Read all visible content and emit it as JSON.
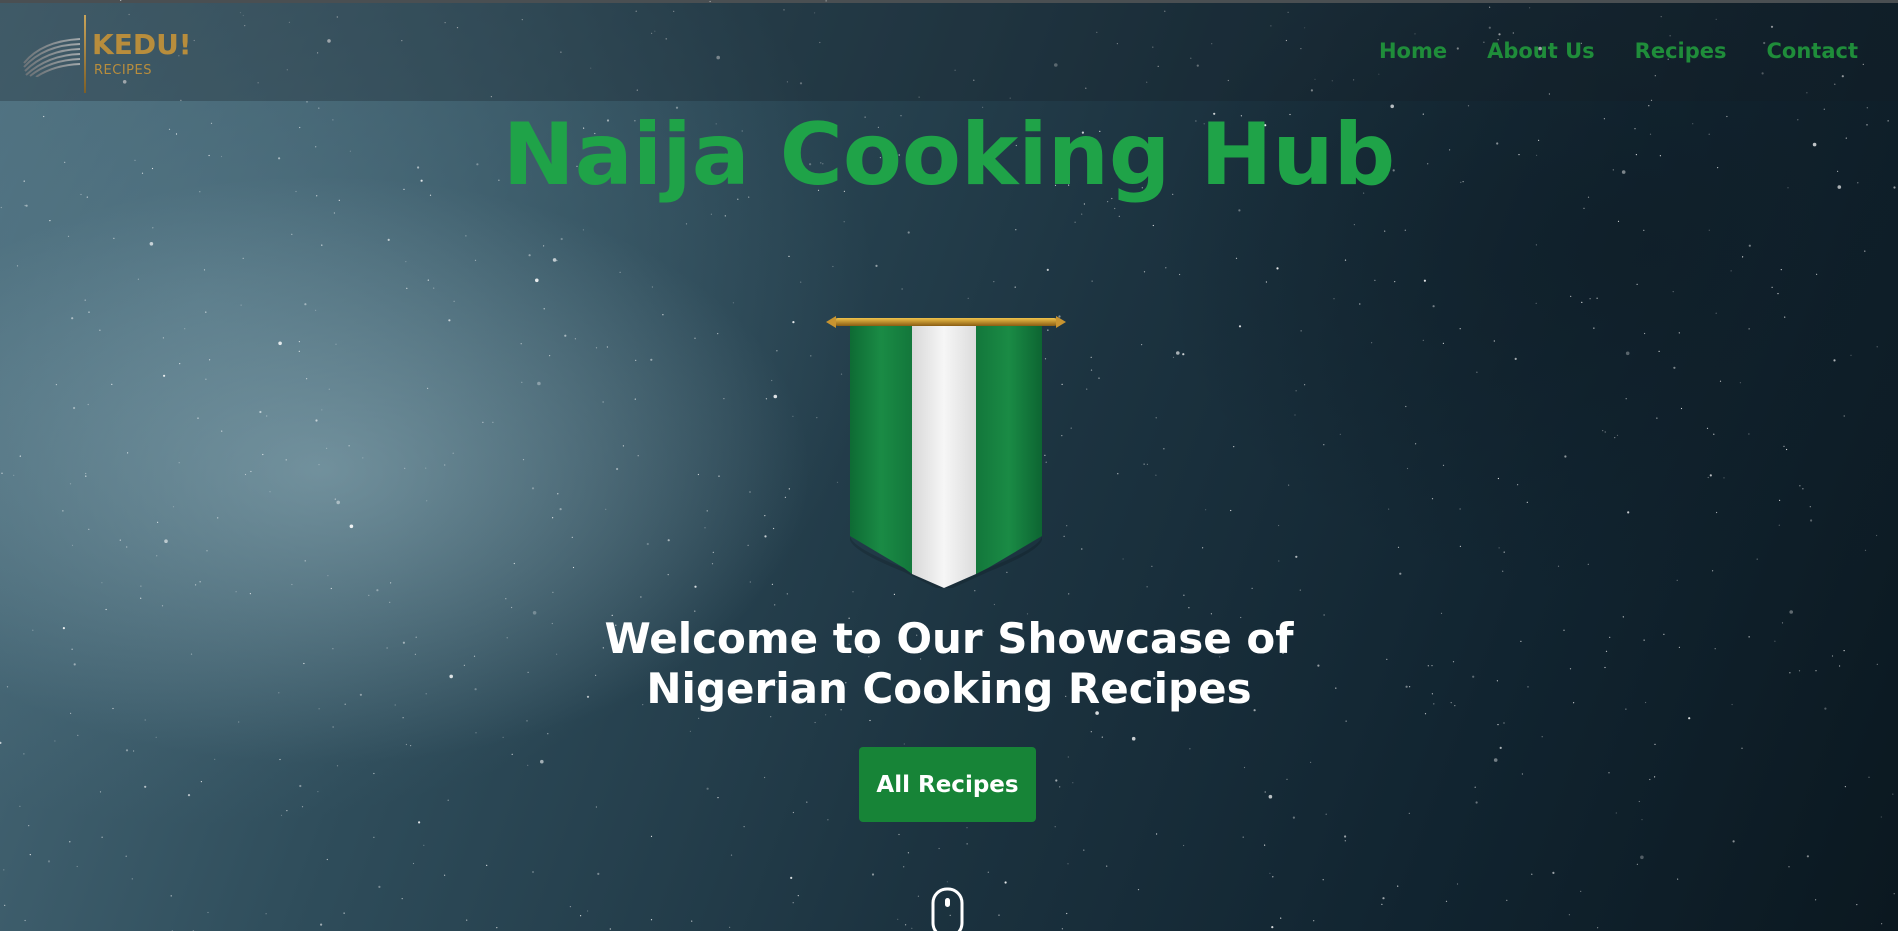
{
  "brand": {
    "name": "KEDU!",
    "tagline": "RECIPES",
    "logo_icon": "stacked-layers-logo-icon",
    "color": "#b88d3c"
  },
  "nav": {
    "items": [
      {
        "label": "Home"
      },
      {
        "label": "About Us"
      },
      {
        "label": "Recipes"
      },
      {
        "label": "Contact"
      }
    ],
    "color": "#1f8d3a"
  },
  "hero": {
    "title": "Naija Cooking Hub",
    "title_color": "#1fa348",
    "flag_icon": "nigeria-flag-pennant-icon",
    "subtitle_line1": "Welcome to Our Showcase of",
    "subtitle_line2": "Nigerian Cooking Recipes",
    "cta_label": "All Recipes",
    "cta_color": "#178437",
    "scroll_icon": "mouse-scroll-icon"
  }
}
